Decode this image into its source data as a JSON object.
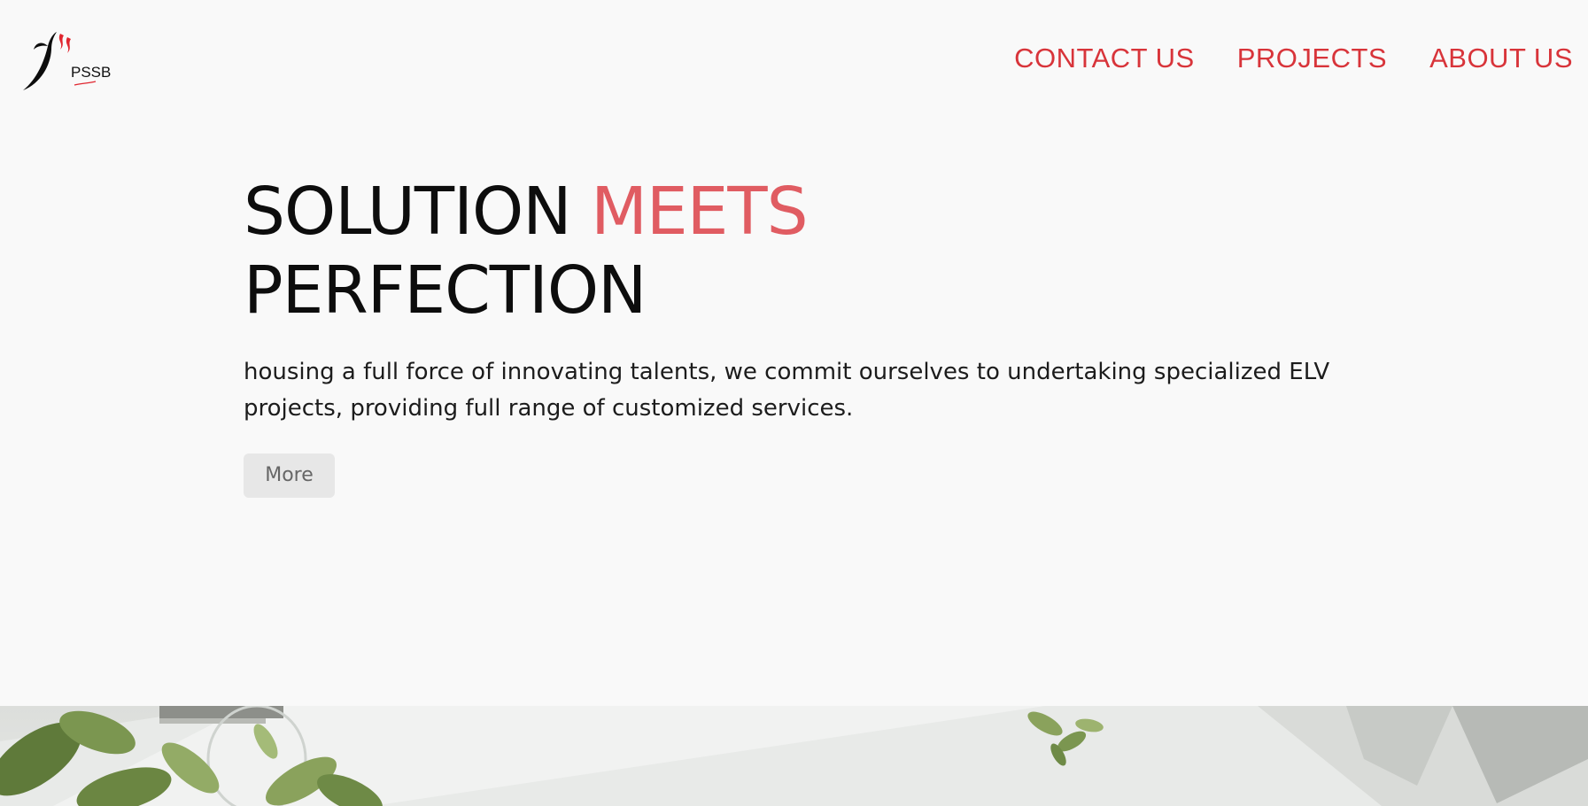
{
  "header": {
    "logo_text": "PSSB",
    "nav": [
      {
        "label": "CONTACT US"
      },
      {
        "label": "PROJECTS"
      },
      {
        "label": "ABOUT US"
      }
    ]
  },
  "hero": {
    "headline_part1": "SOLUTION ",
    "headline_accent": "MEETS",
    "headline_part2": "PERFECTION",
    "description": "housing a full force of innovating talents, we commit ourselves to undertaking specialized ELV projects, providing full range of customized services.",
    "more_label": "More"
  },
  "colors": {
    "accent": "#d8343a",
    "headline_accent": "#e05c62",
    "background": "#f9f9f9",
    "button_bg": "#e7e7e7"
  }
}
